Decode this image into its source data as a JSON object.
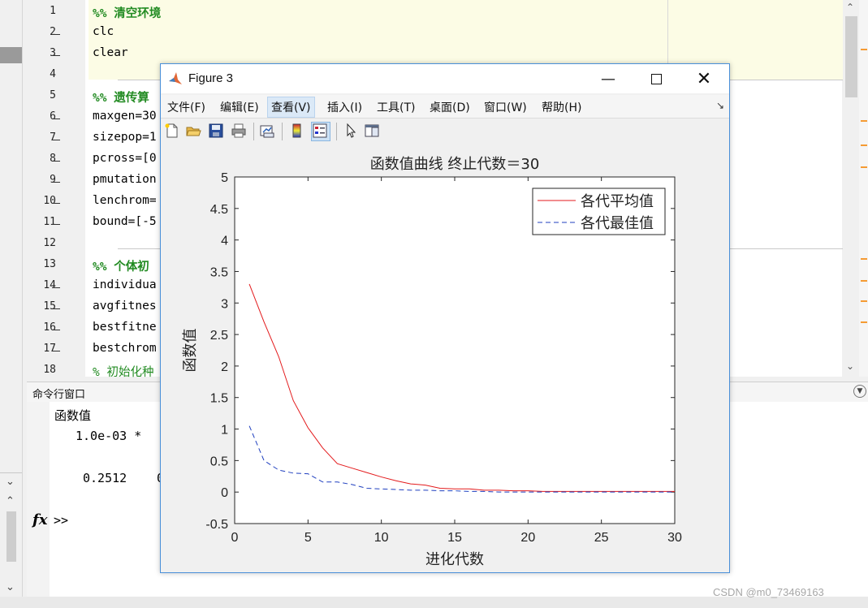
{
  "editor": {
    "lines": [
      {
        "num": "1",
        "text": "%% 清空环境",
        "kind": "sec",
        "dash": false
      },
      {
        "num": "2",
        "text": "clc",
        "kind": "code",
        "dash": true
      },
      {
        "num": "3",
        "text": "clear",
        "kind": "code",
        "dash": true
      },
      {
        "num": "4",
        "text": "",
        "kind": "code",
        "dash": false
      },
      {
        "num": "5",
        "text": "%% 遗传算",
        "kind": "sec",
        "dash": false
      },
      {
        "num": "6",
        "text": "maxgen=30",
        "kind": "code",
        "dash": true
      },
      {
        "num": "7",
        "text": "sizepop=1",
        "kind": "code",
        "dash": true
      },
      {
        "num": "8",
        "text": "pcross=[0",
        "kind": "code",
        "dash": true
      },
      {
        "num": "9",
        "text": "pmutation",
        "kind": "code",
        "dash": true
      },
      {
        "num": "10",
        "text": "lenchrom=",
        "kind": "code",
        "dash": true
      },
      {
        "num": "11",
        "text": "bound=[-5",
        "kind": "code",
        "dash": true
      },
      {
        "num": "12",
        "text": "",
        "kind": "code",
        "dash": false
      },
      {
        "num": "13",
        "text": "%% 个体初",
        "kind": "sec",
        "dash": false
      },
      {
        "num": "14",
        "text": "individua",
        "kind": "code",
        "dash": true
      },
      {
        "num": "15",
        "text": "avgfitnes",
        "kind": "code",
        "dash": true
      },
      {
        "num": "16",
        "text": "bestfitne",
        "kind": "code",
        "dash": true
      },
      {
        "num": "17",
        "text": "bestchrom",
        "kind": "code",
        "dash": true
      },
      {
        "num": "18",
        "text": "% 初始化种",
        "kind": "cm",
        "dash": false
      }
    ]
  },
  "command_window": {
    "title": "命令行窗口",
    "var_label": "函数值",
    "scale": "1.0e-03 *",
    "value_1": "0.2512",
    "value_2": "0",
    "prompt": ">>",
    "fx": "fx"
  },
  "figure": {
    "title": "Figure 3",
    "menus": [
      "文件(F)",
      "编辑(E)",
      "查看(V)",
      "插入(I)",
      "工具(T)",
      "桌面(D)",
      "窗口(W)",
      "帮助(H)"
    ],
    "active_menu": "查看(V)",
    "toolbar_icons": [
      "new-figure-icon",
      "open-file-icon",
      "save-icon",
      "print-icon",
      "link-plot-icon",
      "colorbar-icon",
      "legend-icon",
      "pointer-icon",
      "property-editor-icon"
    ]
  },
  "watermark": "CSDN @m0_73469163",
  "chart_data": {
    "type": "line",
    "title": "函数值曲线  终止代数＝30",
    "xlabel": "进化代数",
    "ylabel": "函数值",
    "xlim": [
      0,
      30
    ],
    "ylim": [
      -0.5,
      5
    ],
    "xticks": [
      "0",
      "5",
      "10",
      "15",
      "20",
      "25",
      "30"
    ],
    "yticks": [
      "-0.5",
      "0",
      "0.5",
      "1",
      "1.5",
      "2",
      "2.5",
      "3",
      "3.5",
      "4",
      "4.5",
      "5"
    ],
    "legend_position": "top-right",
    "grid": false,
    "x": [
      1,
      2,
      3,
      4,
      5,
      6,
      7,
      8,
      9,
      10,
      11,
      12,
      13,
      14,
      15,
      16,
      17,
      18,
      19,
      20,
      21,
      22,
      23,
      24,
      25,
      26,
      27,
      28,
      29,
      30
    ],
    "series": [
      {
        "name": "各代平均值",
        "color": "#e31a1c",
        "style": "solid",
        "values": [
          3.3,
          2.7,
          2.15,
          1.45,
          1.02,
          0.7,
          0.45,
          0.38,
          0.31,
          0.24,
          0.18,
          0.13,
          0.11,
          0.06,
          0.05,
          0.05,
          0.03,
          0.03,
          0.02,
          0.02,
          0.01,
          0.01,
          0.01,
          0.01,
          0.01,
          0.01,
          0.01,
          0.01,
          0.01,
          0.01
        ]
      },
      {
        "name": "各代最佳值",
        "color": "#1f3fbf",
        "style": "dashed",
        "values": [
          1.05,
          0.5,
          0.35,
          0.3,
          0.29,
          0.16,
          0.16,
          0.12,
          0.06,
          0.05,
          0.04,
          0.03,
          0.03,
          0.02,
          0.02,
          0.01,
          0.01,
          0.0,
          0.0,
          0.0,
          0.0,
          0.0,
          0.0,
          0.0,
          0.0,
          0.0,
          0.0,
          0.0,
          0.0,
          0.0
        ]
      }
    ]
  }
}
